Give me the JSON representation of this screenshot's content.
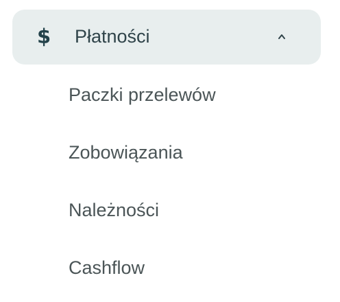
{
  "menu": {
    "header": {
      "icon": "dollar-icon",
      "icon_glyph": "$",
      "label": "Płatności",
      "chevron": "chevron-up-icon",
      "expanded": true
    },
    "items": [
      {
        "label": "Paczki przelewów"
      },
      {
        "label": "Zobowiązania"
      },
      {
        "label": "Należności"
      },
      {
        "label": "Cashflow"
      }
    ]
  },
  "colors": {
    "header_background": "#e8eeee",
    "icon": "#23424a",
    "header_text": "#30444a",
    "item_text": "#4b5557"
  }
}
